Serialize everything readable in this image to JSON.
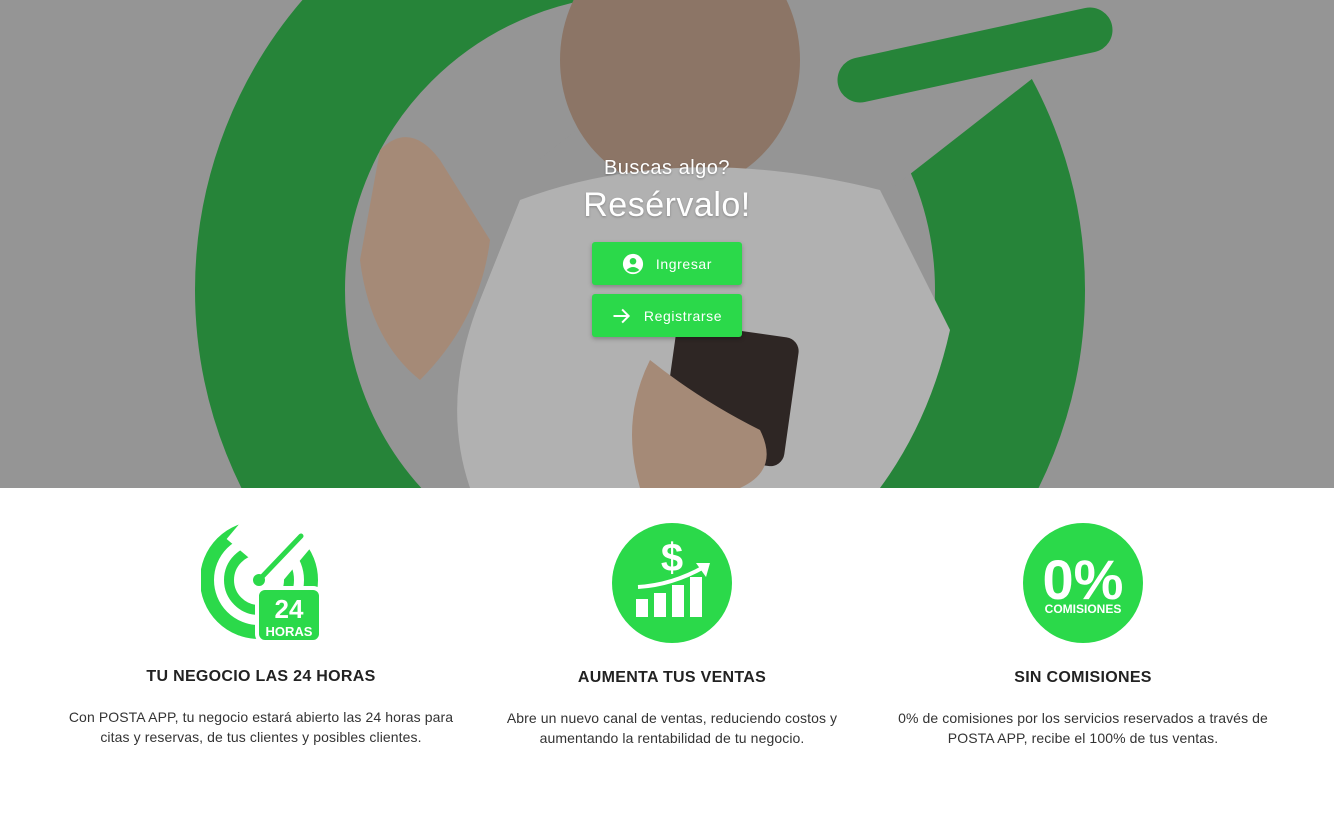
{
  "hero": {
    "subtitle": "Buscas algo?",
    "title": "Resérvalo!",
    "login_label": "Ingresar",
    "register_label": "Registrarse",
    "accent_color": "#2bd94a"
  },
  "features": [
    {
      "icon": "clock-24-hours-icon",
      "icon_text_main": "24",
      "icon_text_sub": "HORAS",
      "title": "TU NEGOCIO LAS 24 HORAS",
      "text": "Con POSTA APP, tu negocio estará abierto las 24 horas para citas y reservas, de tus clientes y posibles clientes."
    },
    {
      "icon": "sales-growth-icon",
      "icon_text_main": "$",
      "title": "AUMENTA TUS VENTAS",
      "text": "Abre un nuevo canal de ventas, reduciendo costos y aumentando la rentabilidad de tu negocio."
    },
    {
      "icon": "zero-percent-icon",
      "icon_text_main": "0%",
      "icon_text_sub": "COMISIONES",
      "title": "SIN COMISIONES",
      "text": "0% de comisiones por los servicios reservados a través de POSTA APP, recibe el 100% de tus ventas."
    }
  ]
}
